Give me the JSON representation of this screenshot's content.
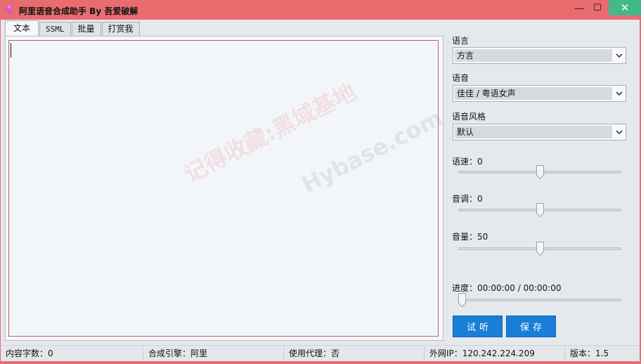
{
  "window": {
    "title": "阿里语音合成助手 By 吾爱破解",
    "minimize_glyph": "—",
    "maximize_glyph": "☐",
    "close_glyph": "✕"
  },
  "tabs": [
    {
      "label": "文本",
      "active": true
    },
    {
      "label": "SSML",
      "active": false
    },
    {
      "label": "批量",
      "active": false
    },
    {
      "label": "打赏我",
      "active": false
    }
  ],
  "editor": {
    "value": "",
    "watermark_text_1": "记得收藏:黑域基地",
    "watermark_text_2": "Hybase.com"
  },
  "settings": {
    "language_label": "语言",
    "language_value": "方言",
    "voice_label": "语音",
    "voice_value": "佳佳 / 粤语女声",
    "style_label": "语音风格",
    "style_value": "默认",
    "speed_label": "语速：0",
    "speed_value": 0,
    "pitch_label": "音调：0",
    "pitch_value": 0,
    "volume_label": "音量：50",
    "volume_value": 50,
    "progress_label": "进度：00:00:00 / 00:00:00",
    "progress_value": 0
  },
  "buttons": {
    "listen_label": "试听",
    "save_label": "保存"
  },
  "statusbar": {
    "char_count": "内容字数：0",
    "engine": "合成引擎：阿里",
    "proxy": "使用代理：否",
    "ip": "外网IP：120.242.224.209",
    "version": "版本：1.5"
  },
  "colors": {
    "title_bar": "#e96c6e",
    "close_button": "#43b987",
    "primary_button": "#1a7ed6",
    "editor_border": "#c85961"
  }
}
